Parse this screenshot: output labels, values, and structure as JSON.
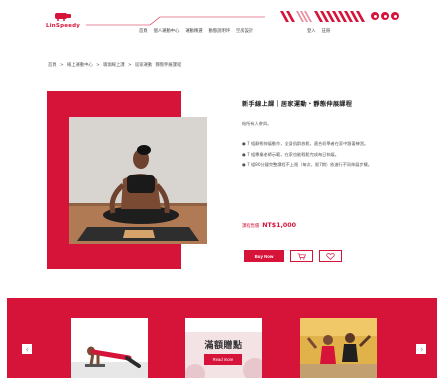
{
  "header": {
    "logo_text": "LinSpeedy",
    "nav": [
      "首頁",
      "個人運動中心",
      "運動精選",
      "動態說明坪",
      "空房設計"
    ],
    "auth": [
      "登入",
      "註冊"
    ],
    "social_icons": [
      "instagram-icon",
      "facebook-icon",
      "line-icon"
    ]
  },
  "breadcrumb": [
    "首頁",
    ">",
    "線上運動中心",
    ">",
    "瑜珈線上課",
    ">",
    "居家運動",
    "靜態伸展課程"
  ],
  "product": {
    "title": "新手線上課｜居家運動・靜態伸展課程",
    "subtitle": "給所有人參與。",
    "features": [
      "● 7 組靜態伸展動作，全身肌群放鬆，適合初學者在家中跟著練習。",
      "● 7 組專業老師示範，在家也能輕鬆完成每日伸展。",
      "● 7 組80分鐘完整課程不上限（每次，限7期）依進行不同伸展步驟。"
    ],
    "price_label": "課程售價",
    "price": "NT$1,000",
    "buy_label": "Buy Now"
  },
  "related": {
    "promo_title": "滿額贈點",
    "promo_button": "Read more"
  },
  "colors": {
    "accent": "#d6143a",
    "background": "#ffffff"
  }
}
